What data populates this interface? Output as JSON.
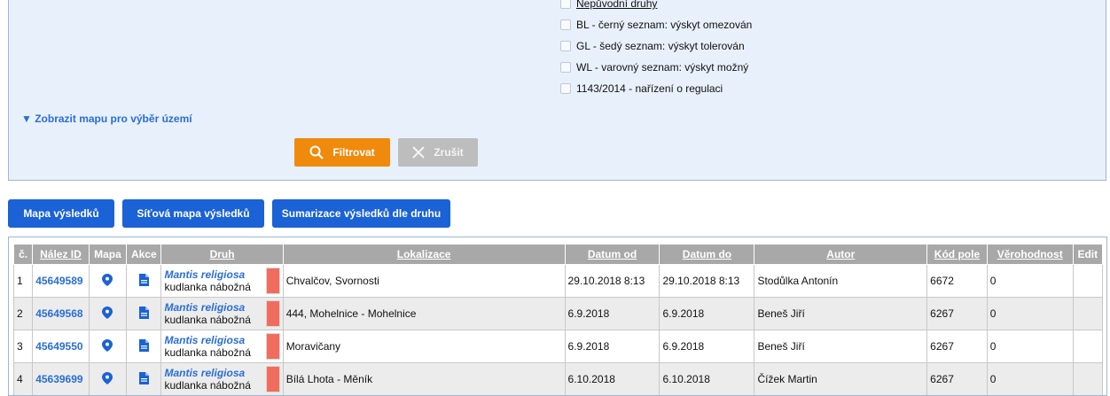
{
  "filters": {
    "checkboxes": [
      {
        "label": "Nepůvodní druhy",
        "checked": false
      },
      {
        "label": "BL - černý seznam: výskyt omezován",
        "checked": false
      },
      {
        "label": "GL - šedý seznam: výskyt tolerován",
        "checked": false
      },
      {
        "label": "WL - varovný seznam: výskyt možný",
        "checked": false
      },
      {
        "label": "1143/2014 - nařízení o regulaci",
        "checked": false
      }
    ],
    "map_toggle": "▼ Zobrazit mapu pro výběr území",
    "filter_button": "Filtrovat",
    "cancel_button": "Zrušit"
  },
  "results_buttons": [
    "Mapa výsledků",
    "Síťová mapa výsledků",
    "Sumarizace výsledků dle druhu"
  ],
  "table": {
    "headers": [
      "č.",
      "Nález ID",
      "Mapa",
      "Akce",
      "Druh",
      "Lokalizace",
      "Datum od",
      "Datum do",
      "Autor",
      "Kód pole",
      "Věrohodnost",
      "Edit"
    ],
    "rows": [
      {
        "n": "1",
        "id": "45649589",
        "species_lat": "Mantis religiosa",
        "species_cz": "kudlanka nábožná",
        "locality": "Chvalčov, Svornosti",
        "date_from": "29.10.2018 8:13",
        "date_to": "29.10.2018 8:13",
        "author": "Stodůlka Antonín",
        "code": "6672",
        "reliability": "0"
      },
      {
        "n": "2",
        "id": "45649568",
        "species_lat": "Mantis religiosa",
        "species_cz": "kudlanka nábožná",
        "locality": "444, Mohelnice - Mohelnice",
        "date_from": "6.9.2018",
        "date_to": "6.9.2018",
        "author": "Beneš Jiří",
        "code": "6267",
        "reliability": "0"
      },
      {
        "n": "3",
        "id": "45649550",
        "species_lat": "Mantis religiosa",
        "species_cz": "kudlanka nábožná",
        "locality": "Moravičany",
        "date_from": "6.9.2018",
        "date_to": "6.9.2018",
        "author": "Beneš Jiří",
        "code": "6267",
        "reliability": "0"
      },
      {
        "n": "4",
        "id": "45639699",
        "species_lat": "Mantis religiosa",
        "species_cz": "kudlanka nábožná",
        "locality": "Bílá Lhota - Měník",
        "date_from": "6.10.2018",
        "date_to": "6.10.2018",
        "author": "Čížek Martin",
        "code": "6267",
        "reliability": "0"
      }
    ]
  },
  "colors": {
    "accent": "#1a62d6",
    "filter": "#f08a0c",
    "status_bar": "#f26c5e"
  },
  "icons": {
    "map_column": "map-pin-icon",
    "action_column": "document-icon"
  }
}
